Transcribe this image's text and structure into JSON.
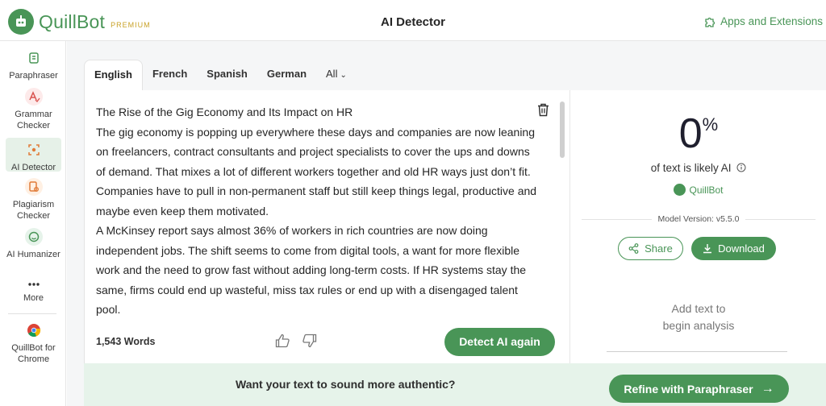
{
  "header": {
    "logo_text": "QuillBot",
    "logo_badge": "PREMIUM",
    "title": "AI Detector",
    "apps_label": "Apps and Extensions"
  },
  "sidebar": {
    "items": [
      {
        "label": "Paraphraser",
        "icon": "paraphraser-icon"
      },
      {
        "label": "Grammar Checker",
        "icon": "grammar-checker-icon"
      },
      {
        "label": "AI Detector",
        "icon": "ai-detector-icon"
      },
      {
        "label": "Plagiarism Checker",
        "icon": "plagiarism-checker-icon"
      },
      {
        "label": "AI Humanizer",
        "icon": "ai-humanizer-icon"
      },
      {
        "label": "More",
        "icon": "more-icon"
      },
      {
        "label": "QuillBot for Chrome",
        "icon": "chrome-icon"
      }
    ]
  },
  "tabs": [
    {
      "label": "English"
    },
    {
      "label": "French"
    },
    {
      "label": "Spanish"
    },
    {
      "label": "German"
    },
    {
      "label": "All"
    }
  ],
  "editor": {
    "paragraphs": [
      "The Rise of the Gig Economy and Its Impact on HR",
      "The gig economy is popping up everywhere these days and companies are now leaning on freelancers, contract consultants and project specialists to cover the ups and downs of demand. That mixes a lot of different workers together and old HR ways just don’t fit. Companies have to pull in non-permanent staff but still keep things legal, productive and maybe even keep them motivated.",
      "A McKinsey report says almost 36% of workers in rich countries are now doing independent jobs. The shift seems to come from digital tools, a want for more flexible work and the need to grow fast without adding long-term costs. If HR systems stay the same, firms could end up wasteful, miss tax rules or end up with a disengaged talent pool."
    ],
    "word_count": "1,543 Words",
    "detect_button": "Detect AI again"
  },
  "result": {
    "percent": "0",
    "percent_sign": "%",
    "likely_text": "of text is likely AI",
    "brand": "QuillBot",
    "model_version": "Model Version: v5.5.0",
    "share_label": "Share",
    "download_label": "Download",
    "add_text_line1": "Add text to",
    "add_text_line2": "begin analysis"
  },
  "banner": {
    "text": "Want your text to sound more authentic?",
    "button": "Refine with Paraphraser"
  },
  "colors": {
    "brand_green": "#499557",
    "premium_gold": "#c9a227",
    "banner_bg": "#e6f3ea"
  }
}
